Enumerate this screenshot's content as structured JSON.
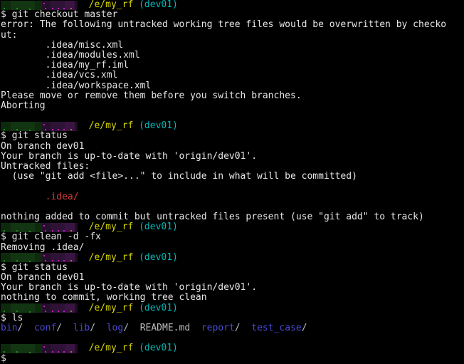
{
  "terminal": {
    "background_color": "#000000",
    "foreground_color": "#e6e6e6",
    "colors": {
      "path": "#d8d800",
      "branch": "#00b7b7",
      "untracked": "#d33b3b",
      "directory": "#4a4ad6",
      "slash": "#bdbdbd",
      "text": "#e6e6e6"
    },
    "prompt": {
      "user_host": "[redacted]",
      "path": "/e/my_rf",
      "branch": "(dev01)",
      "symbol": "$"
    },
    "lines": [
      {
        "type": "prompt"
      },
      {
        "type": "command",
        "text": "$ git checkout master"
      },
      {
        "type": "output",
        "text": "error: The following untracked working tree files would be overwritten by checko"
      },
      {
        "type": "output",
        "text": "ut:"
      },
      {
        "type": "output",
        "text": "        .idea/misc.xml"
      },
      {
        "type": "output",
        "text": "        .idea/modules.xml"
      },
      {
        "type": "output",
        "text": "        .idea/my_rf.iml"
      },
      {
        "type": "output",
        "text": "        .idea/vcs.xml"
      },
      {
        "type": "output",
        "text": "        .idea/workspace.xml"
      },
      {
        "type": "output",
        "text": "Please move or remove them before you switch branches."
      },
      {
        "type": "output",
        "text": "Aborting"
      },
      {
        "type": "blank",
        "text": ""
      },
      {
        "type": "prompt"
      },
      {
        "type": "command",
        "text": "$ git status"
      },
      {
        "type": "output",
        "text": "On branch dev01"
      },
      {
        "type": "output",
        "text": "Your branch is up-to-date with 'origin/dev01'."
      },
      {
        "type": "output",
        "text": "Untracked files:"
      },
      {
        "type": "output",
        "text": "  (use \"git add <file>...\" to include in what will be committed)"
      },
      {
        "type": "blank",
        "text": ""
      },
      {
        "type": "untracked",
        "text": "        .idea/"
      },
      {
        "type": "blank",
        "text": ""
      },
      {
        "type": "output",
        "text": "nothing added to commit but untracked files present (use \"git add\" to track)"
      },
      {
        "type": "prompt"
      },
      {
        "type": "command",
        "text": "$ git clean -d -fx"
      },
      {
        "type": "output",
        "text": "Removing .idea/"
      },
      {
        "type": "prompt"
      },
      {
        "type": "command",
        "text": "$ git status"
      },
      {
        "type": "output",
        "text": "On branch dev01"
      },
      {
        "type": "output",
        "text": "Your branch is up-to-date with 'origin/dev01'."
      },
      {
        "type": "output",
        "text": "nothing to commit, working tree clean"
      },
      {
        "type": "prompt"
      },
      {
        "type": "command",
        "text": "$ ls"
      },
      {
        "type": "ls"
      },
      {
        "type": "blank",
        "text": ""
      },
      {
        "type": "prompt"
      },
      {
        "type": "command",
        "text": "$"
      }
    ],
    "ls_output": {
      "entries": [
        {
          "name": "bin",
          "kind": "dir",
          "suffix": "/"
        },
        {
          "name": "conf",
          "kind": "dir",
          "suffix": "/"
        },
        {
          "name": "lib",
          "kind": "dir",
          "suffix": "/"
        },
        {
          "name": "log",
          "kind": "dir",
          "suffix": "/"
        },
        {
          "name": "README.md",
          "kind": "file",
          "suffix": ""
        },
        {
          "name": "report",
          "kind": "dir",
          "suffix": "/"
        },
        {
          "name": "test_case",
          "kind": "dir",
          "suffix": "/"
        }
      ]
    }
  }
}
